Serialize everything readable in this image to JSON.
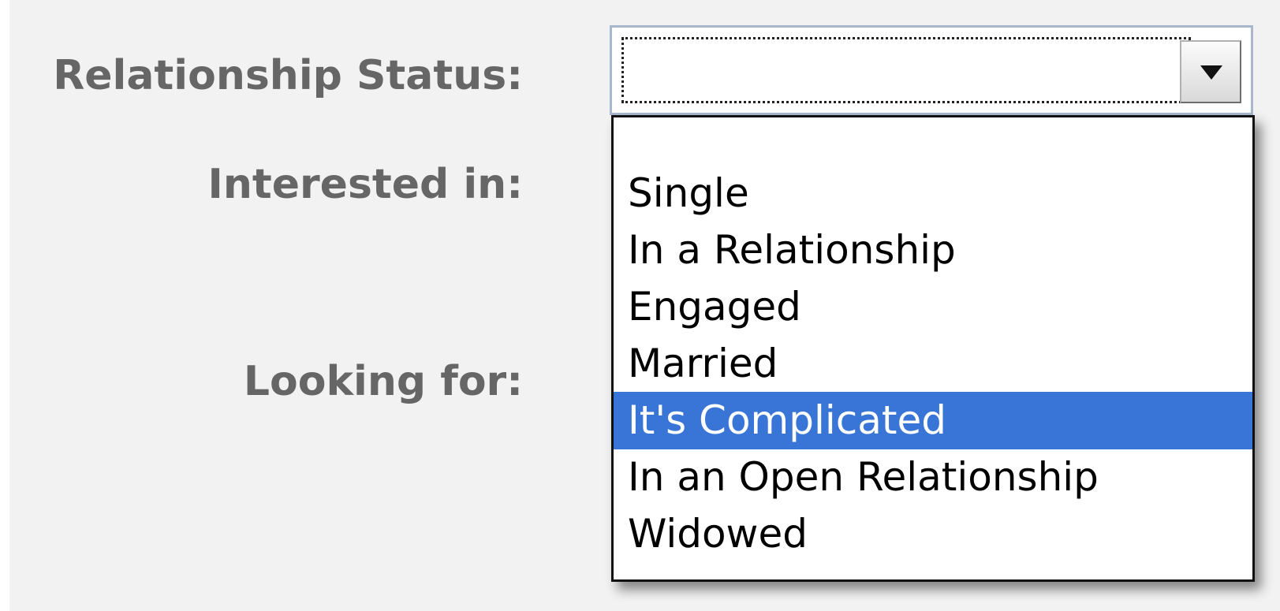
{
  "form": {
    "relationship_label": "Relationship Status:",
    "interested_label": "Interested in:",
    "looking_label": "Looking for:"
  },
  "relationship_select": {
    "selected_value": "",
    "options": [
      "",
      "Single",
      "In a Relationship",
      "Engaged",
      "Married",
      "It's Complicated",
      "In an Open Relationship",
      "Widowed"
    ],
    "highlighted_option": "It's Complicated"
  },
  "icons": {
    "dropdown_arrow": "chevron-down-icon"
  },
  "colors": {
    "panel_background": "#f2f2f2",
    "label_text": "#666666",
    "highlight": "#3875d7",
    "highlight_text": "#ffffff",
    "select_border": "#a8b8cc"
  }
}
